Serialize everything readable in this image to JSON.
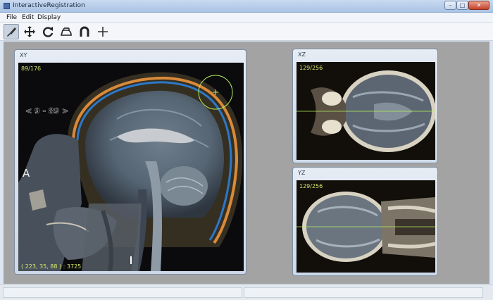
{
  "window": {
    "title": "InteractiveRegistration"
  },
  "menu": {
    "items": [
      "File",
      "Edit",
      "Display"
    ]
  },
  "toolbar": {
    "tools": [
      {
        "icon": "brush-icon",
        "active": true
      },
      {
        "icon": "move-icon",
        "active": false
      },
      {
        "icon": "rotate-icon",
        "active": false
      },
      {
        "icon": "iron-icon",
        "active": false
      },
      {
        "icon": "magnet-icon",
        "active": false
      },
      {
        "icon": "crosshair-icon",
        "active": false
      }
    ]
  },
  "views": {
    "xy": {
      "title": "XY",
      "slice": "89/176",
      "coords": "( 223, 35, 88 ) : 3725",
      "orientation_left": "A",
      "annotation": "< 9 - 89 >"
    },
    "xz": {
      "title": "XZ",
      "slice": "129/256"
    },
    "yz": {
      "title": "YZ",
      "slice": "129/256"
    }
  },
  "colors": {
    "overlay_text": "#d6e86a",
    "cursor_line": "#b6f05a"
  }
}
